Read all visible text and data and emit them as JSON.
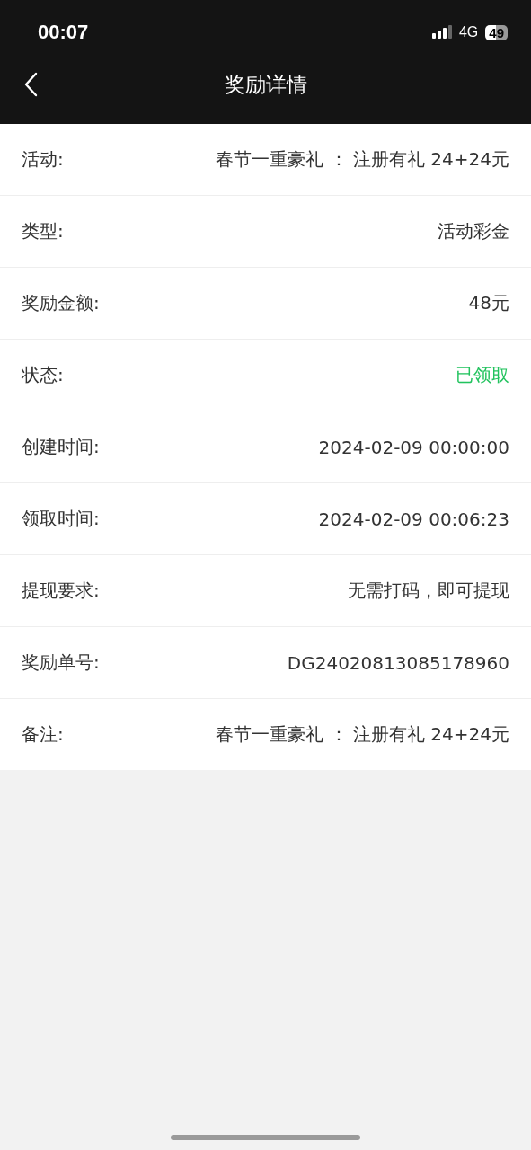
{
  "status_bar": {
    "time": "00:07",
    "network": "4G",
    "battery": "49"
  },
  "nav": {
    "title": "奖励详情"
  },
  "rows": [
    {
      "label": "活动:",
      "value": "春节一重豪礼 ： 注册有礼 24+24元",
      "kind": "text"
    },
    {
      "label": "类型:",
      "value": "活动彩金",
      "kind": "text"
    },
    {
      "label": "奖励金额:",
      "value": "48元",
      "kind": "text"
    },
    {
      "label": "状态:",
      "value": "已领取",
      "kind": "status"
    },
    {
      "label": "创建时间:",
      "value": "2024-02-09 00:00:00",
      "kind": "text"
    },
    {
      "label": "领取时间:",
      "value": "2024-02-09 00:06:23",
      "kind": "text"
    },
    {
      "label": "提现要求:",
      "value": "无需打码，即可提现",
      "kind": "text"
    },
    {
      "label": "奖励单号:",
      "value": "DG24020813085178960",
      "kind": "text"
    },
    {
      "label": "备注:",
      "value": "春节一重豪礼 ： 注册有礼 24+24元",
      "kind": "text"
    }
  ]
}
